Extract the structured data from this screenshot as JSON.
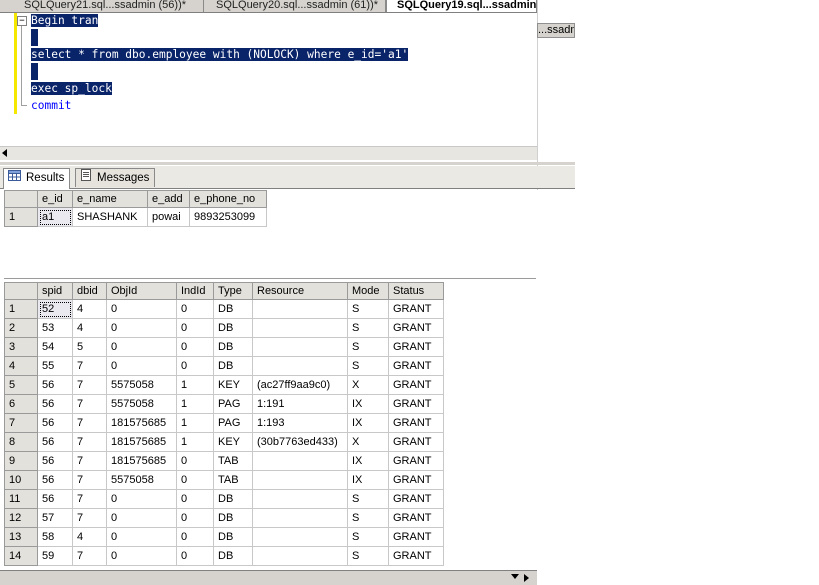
{
  "tabs": [
    {
      "label": "SQLQuery21.sql...ssadmin (56))*",
      "active": false
    },
    {
      "label": "SQLQuery20.sql...ssadmin (61))*",
      "active": false
    },
    {
      "label": "SQLQuery19.sql...ssadmin",
      "active": true
    }
  ],
  "side_tab": "...ssadm",
  "editor": {
    "fold_symbol": "−",
    "lines": [
      "Begin tran",
      "",
      "select * from dbo.employee with (NOLOCK) where e_id='a1'",
      "",
      "exec sp_lock",
      "commit"
    ]
  },
  "results_tabs": {
    "results": "Results",
    "messages": "Messages"
  },
  "grid1": {
    "columns": [
      "e_id",
      "e_name",
      "e_add",
      "e_phone_no"
    ],
    "rows": [
      {
        "n": "1",
        "cells": [
          "a1",
          "SHASHANK",
          "powai",
          "9893253099"
        ]
      }
    ]
  },
  "grid2": {
    "columns": [
      "spid",
      "dbid",
      "ObjId",
      "IndId",
      "Type",
      "Resource",
      "Mode",
      "Status"
    ],
    "rows": [
      {
        "n": "1",
        "cells": [
          "52",
          "4",
          "0",
          "0",
          "DB",
          "",
          "S",
          "GRANT"
        ]
      },
      {
        "n": "2",
        "cells": [
          "53",
          "4",
          "0",
          "0",
          "DB",
          "",
          "S",
          "GRANT"
        ]
      },
      {
        "n": "3",
        "cells": [
          "54",
          "5",
          "0",
          "0",
          "DB",
          "",
          "S",
          "GRANT"
        ]
      },
      {
        "n": "4",
        "cells": [
          "55",
          "7",
          "0",
          "0",
          "DB",
          "",
          "S",
          "GRANT"
        ]
      },
      {
        "n": "5",
        "cells": [
          "56",
          "7",
          "5575058",
          "1",
          "KEY",
          "(ac27ff9aa9c0)",
          "X",
          "GRANT"
        ]
      },
      {
        "n": "6",
        "cells": [
          "56",
          "7",
          "5575058",
          "1",
          "PAG",
          "1:191",
          "IX",
          "GRANT"
        ]
      },
      {
        "n": "7",
        "cells": [
          "56",
          "7",
          "181575685",
          "1",
          "PAG",
          "1:193",
          "IX",
          "GRANT"
        ]
      },
      {
        "n": "8",
        "cells": [
          "56",
          "7",
          "181575685",
          "1",
          "KEY",
          "(30b7763ed433)",
          "X",
          "GRANT"
        ]
      },
      {
        "n": "9",
        "cells": [
          "56",
          "7",
          "181575685",
          "0",
          "TAB",
          "",
          "IX",
          "GRANT"
        ]
      },
      {
        "n": "10",
        "cells": [
          "56",
          "7",
          "5575058",
          "0",
          "TAB",
          "",
          "IX",
          "GRANT"
        ]
      },
      {
        "n": "11",
        "cells": [
          "56",
          "7",
          "0",
          "0",
          "DB",
          "",
          "S",
          "GRANT"
        ]
      },
      {
        "n": "12",
        "cells": [
          "57",
          "7",
          "0",
          "0",
          "DB",
          "",
          "S",
          "GRANT"
        ]
      },
      {
        "n": "13",
        "cells": [
          "58",
          "4",
          "0",
          "0",
          "DB",
          "",
          "S",
          "GRANT"
        ]
      },
      {
        "n": "14",
        "cells": [
          "59",
          "7",
          "0",
          "0",
          "DB",
          "",
          "S",
          "GRANT"
        ]
      }
    ]
  }
}
